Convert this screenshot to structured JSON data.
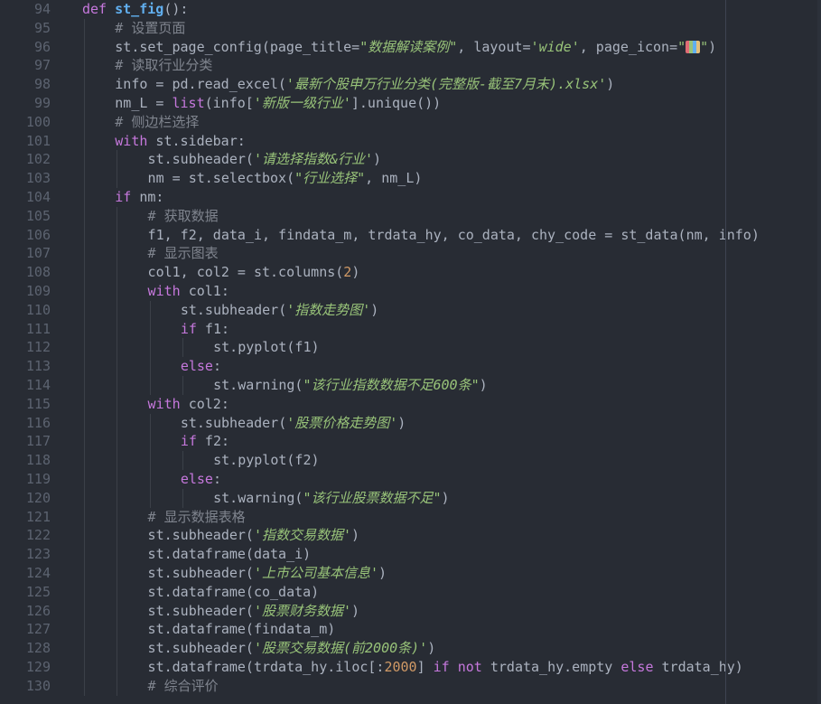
{
  "editor": {
    "theme": {
      "background": "#282c34",
      "keyword": "#c678dd",
      "function": "#61afef",
      "string": "#98c379",
      "number": "#d19a66",
      "comment": "#7f848e",
      "text": "#abb2bf",
      "line_number": "#5c6370"
    }
  },
  "lines": [
    {
      "num": "94",
      "indent": 0,
      "tokens": [
        [
          "kw",
          "def"
        ],
        [
          "t",
          " "
        ],
        [
          "def",
          "st_fig"
        ],
        [
          "t",
          "():"
        ]
      ]
    },
    {
      "num": "95",
      "indent": 1,
      "tokens": [
        [
          "cm",
          "# 设置页面"
        ]
      ]
    },
    {
      "num": "96",
      "indent": 1,
      "tokens": [
        [
          "t",
          "st.set_page_config(page_title="
        ],
        [
          "str",
          "\"数据解读案例\""
        ],
        [
          "t",
          ", layout="
        ],
        [
          "str",
          "'wide'"
        ],
        [
          "t",
          ", page_icon="
        ],
        [
          "str",
          "\""
        ],
        [
          "icon",
          "page-icon-glyph"
        ],
        [
          "str",
          "\""
        ],
        [
          "t",
          ")"
        ]
      ]
    },
    {
      "num": "97",
      "indent": 1,
      "tokens": [
        [
          "cm",
          "# 读取行业分类"
        ]
      ]
    },
    {
      "num": "98",
      "indent": 1,
      "tokens": [
        [
          "t",
          "info = pd.read_excel("
        ],
        [
          "str",
          "'最新个股申万行业分类(完整版-截至7月末).xlsx'"
        ],
        [
          "t",
          ")"
        ]
      ]
    },
    {
      "num": "99",
      "indent": 1,
      "tokens": [
        [
          "t",
          "nm_L = "
        ],
        [
          "kw",
          "list"
        ],
        [
          "t",
          "(info["
        ],
        [
          "str",
          "'新版一级行业'"
        ],
        [
          "t",
          "].unique())"
        ]
      ]
    },
    {
      "num": "100",
      "indent": 1,
      "tokens": [
        [
          "cm",
          "# 侧边栏选择"
        ]
      ]
    },
    {
      "num": "101",
      "indent": 1,
      "tokens": [
        [
          "kw",
          "with"
        ],
        [
          "t",
          " st.sidebar:"
        ]
      ]
    },
    {
      "num": "102",
      "indent": 2,
      "tokens": [
        [
          "t",
          "st.subheader("
        ],
        [
          "str",
          "'请选择指数&行业'"
        ],
        [
          "t",
          ")"
        ]
      ]
    },
    {
      "num": "103",
      "indent": 2,
      "tokens": [
        [
          "t",
          "nm = st.selectbox("
        ],
        [
          "str",
          "\"行业选择\""
        ],
        [
          "t",
          ", nm_L)"
        ]
      ]
    },
    {
      "num": "104",
      "indent": 1,
      "tokens": [
        [
          "kw",
          "if"
        ],
        [
          "t",
          " nm:"
        ]
      ]
    },
    {
      "num": "105",
      "indent": 2,
      "tokens": [
        [
          "cm",
          "# 获取数据"
        ]
      ]
    },
    {
      "num": "106",
      "indent": 2,
      "tokens": [
        [
          "t",
          "f1, f2, data_i, findata_m, trdata_hy, co_data, chy_code = st_data(nm, info)"
        ]
      ]
    },
    {
      "num": "107",
      "indent": 2,
      "tokens": [
        [
          "cm",
          "# 显示图表"
        ]
      ]
    },
    {
      "num": "108",
      "indent": 2,
      "tokens": [
        [
          "t",
          "col1, col2 = st.columns("
        ],
        [
          "num",
          "2"
        ],
        [
          "t",
          ")"
        ]
      ]
    },
    {
      "num": "109",
      "indent": 2,
      "tokens": [
        [
          "kw",
          "with"
        ],
        [
          "t",
          " col1:"
        ]
      ]
    },
    {
      "num": "110",
      "indent": 3,
      "tokens": [
        [
          "t",
          "st.subheader("
        ],
        [
          "str",
          "'指数走势图'"
        ],
        [
          "t",
          ")"
        ]
      ]
    },
    {
      "num": "111",
      "indent": 3,
      "tokens": [
        [
          "kw",
          "if"
        ],
        [
          "t",
          " f1:"
        ]
      ]
    },
    {
      "num": "112",
      "indent": 4,
      "tokens": [
        [
          "t",
          "st.pyplot(f1)"
        ]
      ]
    },
    {
      "num": "113",
      "indent": 3,
      "tokens": [
        [
          "kw",
          "else"
        ],
        [
          "t",
          ":"
        ]
      ]
    },
    {
      "num": "114",
      "indent": 4,
      "tokens": [
        [
          "t",
          "st.warning("
        ],
        [
          "str",
          "\"该行业指数数据不足600条\""
        ],
        [
          "t",
          ")"
        ]
      ]
    },
    {
      "num": "115",
      "indent": 2,
      "tokens": [
        [
          "kw",
          "with"
        ],
        [
          "t",
          " col2:"
        ]
      ]
    },
    {
      "num": "116",
      "indent": 3,
      "tokens": [
        [
          "t",
          "st.subheader("
        ],
        [
          "str",
          "'股票价格走势图'"
        ],
        [
          "t",
          ")"
        ]
      ]
    },
    {
      "num": "117",
      "indent": 3,
      "tokens": [
        [
          "kw",
          "if"
        ],
        [
          "t",
          " f2:"
        ]
      ]
    },
    {
      "num": "118",
      "indent": 4,
      "tokens": [
        [
          "t",
          "st.pyplot(f2)"
        ]
      ]
    },
    {
      "num": "119",
      "indent": 3,
      "tokens": [
        [
          "kw",
          "else"
        ],
        [
          "t",
          ":"
        ]
      ]
    },
    {
      "num": "120",
      "indent": 4,
      "tokens": [
        [
          "t",
          "st.warning("
        ],
        [
          "str",
          "\"该行业股票数据不足\""
        ],
        [
          "t",
          ")"
        ]
      ]
    },
    {
      "num": "121",
      "indent": 2,
      "tokens": [
        [
          "cm",
          "# 显示数据表格"
        ]
      ]
    },
    {
      "num": "122",
      "indent": 2,
      "tokens": [
        [
          "t",
          "st.subheader("
        ],
        [
          "str",
          "'指数交易数据'"
        ],
        [
          "t",
          ")"
        ]
      ]
    },
    {
      "num": "123",
      "indent": 2,
      "tokens": [
        [
          "t",
          "st.dataframe(data_i)"
        ]
      ]
    },
    {
      "num": "124",
      "indent": 2,
      "tokens": [
        [
          "t",
          "st.subheader("
        ],
        [
          "str",
          "'上市公司基本信息'"
        ],
        [
          "t",
          ")"
        ]
      ]
    },
    {
      "num": "125",
      "indent": 2,
      "tokens": [
        [
          "t",
          "st.dataframe(co_data)"
        ]
      ]
    },
    {
      "num": "126",
      "indent": 2,
      "tokens": [
        [
          "t",
          "st.subheader("
        ],
        [
          "str",
          "'股票财务数据'"
        ],
        [
          "t",
          ")"
        ]
      ]
    },
    {
      "num": "127",
      "indent": 2,
      "tokens": [
        [
          "t",
          "st.dataframe(findata_m)"
        ]
      ]
    },
    {
      "num": "128",
      "indent": 2,
      "tokens": [
        [
          "t",
          "st.subheader("
        ],
        [
          "str",
          "'股票交易数据(前2000条)'"
        ],
        [
          "t",
          ")"
        ]
      ]
    },
    {
      "num": "129",
      "indent": 2,
      "tokens": [
        [
          "t",
          "st.dataframe(trdata_hy.iloc[:"
        ],
        [
          "num",
          "2000"
        ],
        [
          "t",
          "] "
        ],
        [
          "kw",
          "if"
        ],
        [
          "t",
          " "
        ],
        [
          "kw",
          "not"
        ],
        [
          "t",
          " trdata_hy.empty "
        ],
        [
          "kw",
          "else"
        ],
        [
          "t",
          " trdata_hy)"
        ]
      ]
    },
    {
      "num": "130",
      "indent": 2,
      "tokens": [
        [
          "cm",
          "# 综合评价"
        ]
      ]
    }
  ]
}
